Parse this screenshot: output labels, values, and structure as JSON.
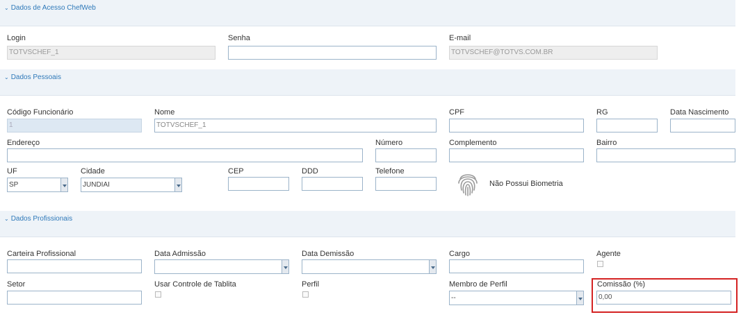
{
  "sections": {
    "acesso": {
      "title": "Dados de Acesso ChefWeb"
    },
    "pessoais": {
      "title": "Dados Pessoais"
    },
    "profissionais": {
      "title": "Dados Profissionais"
    }
  },
  "acesso": {
    "login_label": "Login",
    "login_value": "TOTVSCHEF_1",
    "senha_label": "Senha",
    "senha_value": "",
    "email_label": "E-mail",
    "email_value": "TOTVSCHEF@TOTVS.COM.BR"
  },
  "pessoais": {
    "codigo_label": "Código Funcionário",
    "codigo_value": "1",
    "nome_label": "Nome",
    "nome_value": "TOTVSCHEF_1",
    "cpf_label": "CPF",
    "cpf_value": "",
    "rg_label": "RG",
    "rg_value": "",
    "nascimento_label": "Data Nascimento",
    "nascimento_value": "",
    "endereco_label": "Endereço",
    "endereco_value": "",
    "numero_label": "Número",
    "numero_value": "",
    "complemento_label": "Complemento",
    "complemento_value": "",
    "bairro_label": "Bairro",
    "bairro_value": "",
    "uf_label": "UF",
    "uf_value": "SP",
    "cidade_label": "Cidade",
    "cidade_value": "JUNDIAI",
    "cep_label": "CEP",
    "cep_value": "",
    "ddd_label": "DDD",
    "ddd_value": "",
    "telefone_label": "Telefone",
    "telefone_value": "",
    "biometria_text": "Não Possui Biometria"
  },
  "profissionais": {
    "carteira_label": "Carteira Profissional",
    "carteira_value": "",
    "admissao_label": "Data Admissão",
    "admissao_value": "",
    "demissao_label": "Data Demissão",
    "demissao_value": "",
    "cargo_label": "Cargo",
    "cargo_value": "",
    "agente_label": "Agente",
    "agente_checked": false,
    "setor_label": "Setor",
    "setor_value": "",
    "tablita_label": "Usar Controle de Tablita",
    "tablita_checked": false,
    "perfil_label": "Perfil",
    "perfil_checked": false,
    "membro_label": "Membro de Perfil",
    "membro_value": "--",
    "comissao_label": "Comissão (%)",
    "comissao_value": "0,00"
  },
  "icons": {
    "section_toggle": "chevron-down-icon",
    "biometria": "fingerprint-icon"
  },
  "colors": {
    "section_bg": "#eef3f8",
    "section_title": "#2f79b9",
    "highlight": "#d42222",
    "input_border": "#9bb3c9"
  }
}
